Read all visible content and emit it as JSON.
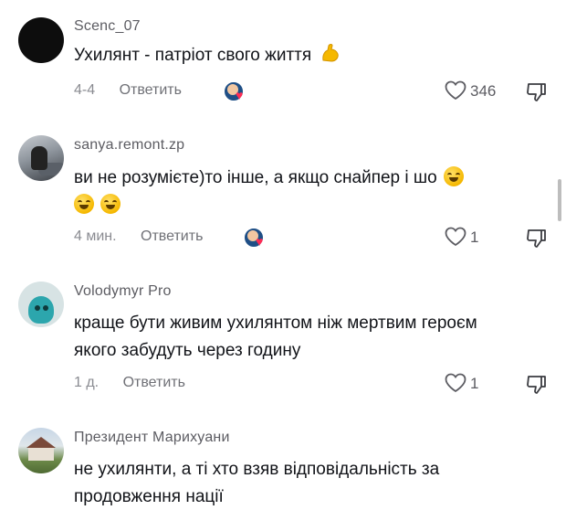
{
  "comments": [
    {
      "username": "Scenc_07",
      "text": "Ухилянт - патріот свого життя",
      "emoji": "flexed-biceps",
      "time": "4-4",
      "reply_label": "Ответить",
      "creator_liked": true,
      "likes": "346"
    },
    {
      "username": "sanya.remont.zp",
      "text_line1": "ви не розумієте)то інше, а якщо снайпер і шо",
      "emoji": "rolling-on-floor-laughing",
      "time": "4 мин.",
      "reply_label": "Ответить",
      "creator_liked": true,
      "likes": "1"
    },
    {
      "username": "Volodymyr Pro",
      "text_line1": "краще бути живим ухилянтом ніж мертвим героєм",
      "text_line2": "якого забудуть через годину",
      "time": "1 д.",
      "reply_label": "Ответить",
      "creator_liked": false,
      "likes": "1"
    },
    {
      "username": "Президент Марихуани",
      "text_line1": "не ухилянти, а ті хто взяв відповідальність за",
      "text_line2": "продовження нації"
    }
  ],
  "icons": {
    "like": "heart-outline-icon",
    "dislike": "thumbs-down-icon",
    "creator_badge": "creator-liked-heart-icon"
  },
  "colors": {
    "accent_heart": "#fe2c55",
    "text": "#111318",
    "muted": "#8a8b91"
  }
}
